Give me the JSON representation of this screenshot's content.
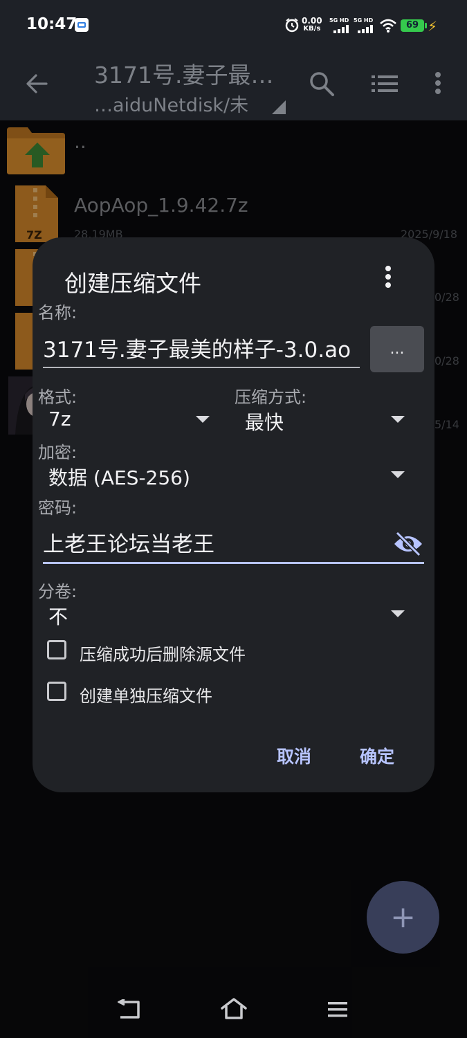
{
  "status_bar": {
    "time": "10:47",
    "speed_value": "0.00",
    "speed_unit": "KB/s",
    "net1": "5G HD",
    "net2": "5G HD",
    "battery": "69"
  },
  "app_bar": {
    "title": "3171号.妻子最…",
    "path": "…aiduNetdisk/未"
  },
  "file_list": [
    {
      "name": "..",
      "meta": "",
      "date": "",
      "icon": "folder-up-icon"
    },
    {
      "name": "AopAop_1.9.42.7z",
      "meta": "28.19MB",
      "date": "2025/9/18",
      "icon": "7z-file-icon"
    },
    {
      "name": "",
      "meta": "",
      "date": "0/28",
      "icon": "7z-file-icon"
    },
    {
      "name": "",
      "meta": "",
      "date": "0/28",
      "icon": "7z-file-icon"
    },
    {
      "name": "",
      "meta": "",
      "date": "5/14",
      "icon": "image-thumbnail"
    }
  ],
  "file_icon_label": "7Z",
  "dialog": {
    "title": "创建压缩文件",
    "name_label": "名称:",
    "name_value": "3171号.妻子最美的样子-3.0.ao",
    "browse_label": "...",
    "format_label": "格式:",
    "format_value": "7z",
    "method_label": "压缩方式:",
    "method_value": "最快",
    "encrypt_label": "加密:",
    "encrypt_value": "数据 (AES-256)",
    "password_label": "密码:",
    "password_value": "上老王论坛当老王",
    "split_label": "分卷:",
    "split_value": "不",
    "delete_source_label": "压缩成功后删除源文件",
    "separate_archive_label": "创建单独压缩文件",
    "cancel_label": "取消",
    "ok_label": "确定"
  },
  "fab_label": "+",
  "colors": {
    "accent": "#b7c4ff",
    "folder": "#e0922e",
    "battery": "#35c94d"
  }
}
